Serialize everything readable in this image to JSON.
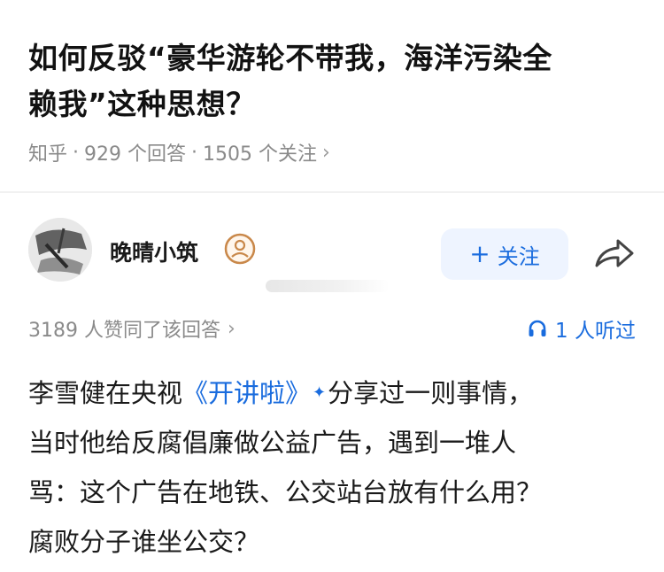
{
  "question": {
    "title_line1": "如何反驳“豪华游轮不带我，海洋污染全",
    "title_line2": "赖我”这种思想？",
    "source": "知乎",
    "answers": "929 个回答",
    "followers": "1505 个关注"
  },
  "author": {
    "name": "晚晴小筑",
    "follow_label": "关注"
  },
  "stats": {
    "agree": "3189 人赞同了该回答",
    "listen": "1 人听过"
  },
  "answer": {
    "line1_pre": "李雪健在央视",
    "line1_link": "《开讲啦》",
    "line1_post": "分享过一则事情，",
    "line2": "当时他给反腐倡廉做公益广告，遇到一堆人",
    "line3": "骂：这个广告在地铁、公交站台放有什么用？",
    "line4": "腐败分子谁坐公交？"
  },
  "icons": {
    "share": "share-icon",
    "headphone": "headphone-icon",
    "badge": "certified-badge-icon",
    "chevron": "chevron-right-icon"
  },
  "colors": {
    "accent": "#1a6cde",
    "muted": "#8a8a8a"
  }
}
